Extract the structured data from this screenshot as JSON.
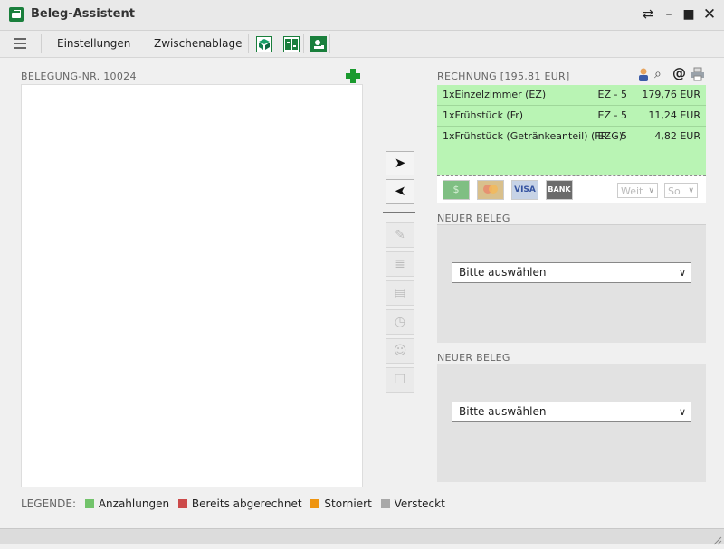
{
  "window": {
    "title": "Beleg-Assistent"
  },
  "toolbar": {
    "settings_label": "Einstellungen",
    "clipboard_label": "Zwischenablage"
  },
  "booking": {
    "label": "BELEGUNG-NR. 10024"
  },
  "invoice": {
    "label": "RECHNUNG [195,81 EUR]",
    "rows": [
      {
        "description": "1xEinzelzimmer (EZ)",
        "code": "EZ - 5",
        "amount": "179,76 EUR"
      },
      {
        "description": "1xFrühstück (Fr)",
        "code": "EZ - 5",
        "amount": "11,24 EUR"
      },
      {
        "description": "1xFrühstück (Getränkeanteil) (FR-G)",
        "code": "EZ - 5",
        "amount": "4,82 EUR"
      }
    ],
    "payment_methods": [
      {
        "icon": "cash-icon",
        "label": "$"
      },
      {
        "icon": "mastercard-icon",
        "label": ""
      },
      {
        "icon": "visa-icon",
        "label": "VISA"
      },
      {
        "icon": "bank-icon",
        "label": "BANK"
      }
    ],
    "further_select": "Weit",
    "so_select": "So"
  },
  "receipts": [
    {
      "label": "NEUER BELEG",
      "select_value": "Bitte auswählen"
    },
    {
      "label": "NEUER BELEG",
      "select_value": "Bitte auswählen"
    }
  ],
  "legend": {
    "label": "LEGENDE:",
    "items": [
      {
        "label": "Anzahlungen",
        "color": "#72c36b"
      },
      {
        "label": "Bereits abgerechnet",
        "color": "#cc4a4a"
      },
      {
        "label": "Storniert",
        "color": "#ee9410"
      },
      {
        "label": "Versteckt",
        "color": "#a8a8a8"
      }
    ]
  },
  "colors": {
    "accent": "#1a7f3c",
    "invoice_bg": "#b9f4b4"
  }
}
